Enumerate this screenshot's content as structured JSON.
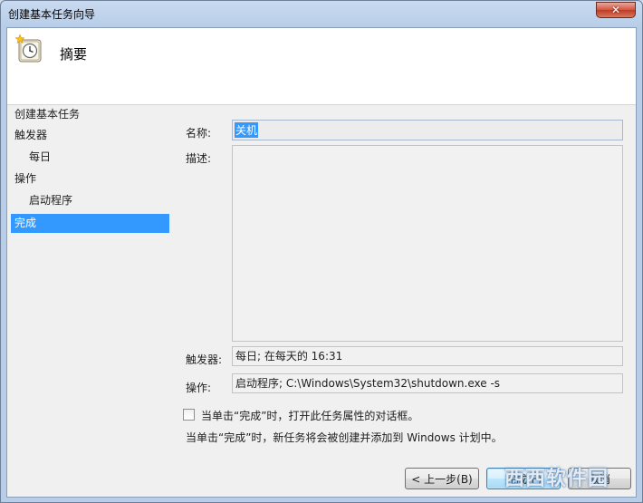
{
  "window": {
    "title": "创建基本任务向导",
    "close_glyph": "✕"
  },
  "header": {
    "title": "摘要",
    "icon": "clock-icon"
  },
  "nav": {
    "items": [
      {
        "label": "创建基本任务",
        "level": 0,
        "active": false
      },
      {
        "label": "触发器",
        "level": 0,
        "active": false
      },
      {
        "label": "每日",
        "level": 1,
        "active": false
      },
      {
        "label": "操作",
        "level": 0,
        "active": false
      },
      {
        "label": "启动程序",
        "level": 1,
        "active": false
      },
      {
        "label": "完成",
        "level": 0,
        "active": true
      }
    ]
  },
  "form": {
    "name_label": "名称:",
    "name_value": "关机",
    "desc_label": "描述:",
    "desc_value": "",
    "trigger_label": "触发器:",
    "trigger_value": "每日; 在每天的 16:31",
    "action_label": "操作:",
    "action_value": "启动程序; C:\\Windows\\System32\\shutdown.exe -s"
  },
  "options": {
    "open_properties_label": "当单击“完成”时，打开此任务属性的对话框。",
    "open_properties_checked": false,
    "info_text": "当单击“完成”时，新任务将会被创建并添加到 Windows 计划中。"
  },
  "buttons": {
    "back": "< 上一步(B)",
    "finish": "完成(F)",
    "cancel": "取消"
  },
  "watermark": "西西软件园",
  "colors": {
    "selection": "#3399ff",
    "close_button": "#c13a22"
  }
}
